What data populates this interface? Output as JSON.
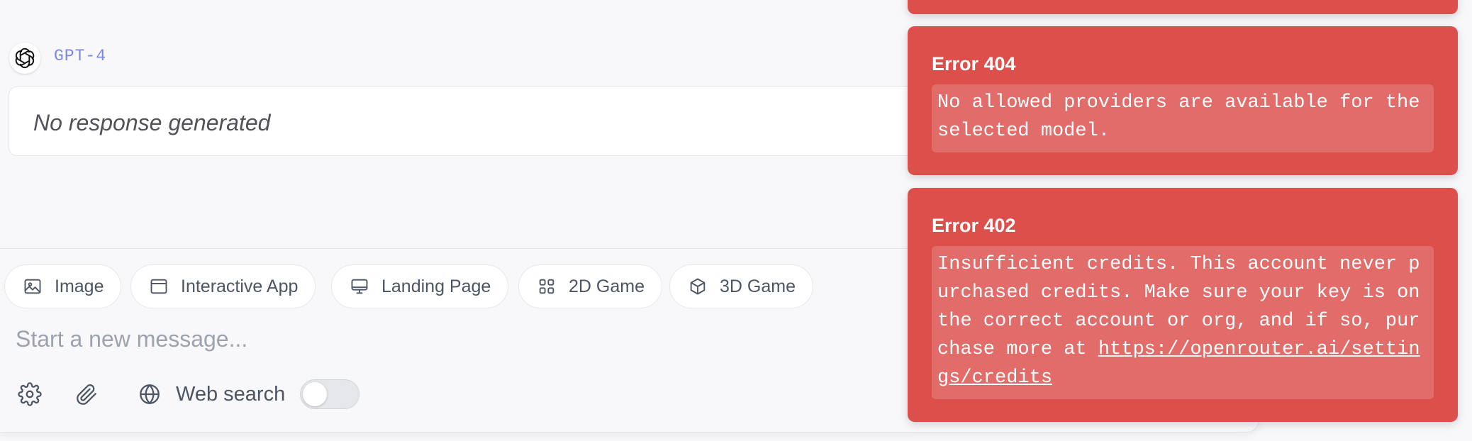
{
  "message": {
    "model_name": "GPT-4",
    "avatar_icon": "openai-logo-icon",
    "response_text": "No response generated"
  },
  "composer": {
    "chips": [
      {
        "label": "Image",
        "icon": "image-icon"
      },
      {
        "label": "Interactive App",
        "icon": "app-window-icon"
      },
      {
        "label": "Landing Page",
        "icon": "monitor-icon"
      },
      {
        "label": "2D Game",
        "icon": "grid-icon"
      },
      {
        "label": "3D Game",
        "icon": "cube-icon"
      }
    ],
    "placeholder": "Start a new message...",
    "settings_icon": "gear-icon",
    "attach_icon": "paperclip-icon",
    "web_search_icon": "globe-icon",
    "web_search_label": "Web search",
    "web_search_enabled": false
  },
  "toasts": [
    {
      "title": "Error 404",
      "message": "No allowed providers are available for the selected model."
    },
    {
      "title": "Error 402",
      "message": "Insufficient credits. This account never purchased credits. Make sure your key is on the correct account or org, and if so, purchase more at ",
      "link": "https://openrouter.ai/settings/credits"
    }
  ],
  "colors": {
    "toast_bg": "#dc4f4b",
    "model_name": "#7b87e6",
    "page_bg": "#f8f8fa"
  }
}
